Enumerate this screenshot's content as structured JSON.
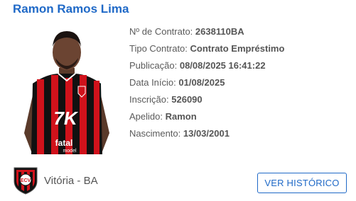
{
  "player": {
    "name": "Ramon Ramos Lima"
  },
  "details": [
    {
      "label": "Nº de Contrato:",
      "value": "2638110BA"
    },
    {
      "label": "Tipo Contrato:",
      "value": "Contrato Empréstimo"
    },
    {
      "label": "Publicação:",
      "value": "08/08/2025 16:41:22"
    },
    {
      "label": "Data Início:",
      "value": "01/08/2025"
    },
    {
      "label": "Inscrição:",
      "value": "526090"
    },
    {
      "label": "Apelido:",
      "value": "Ramon"
    },
    {
      "label": "Nascimento:",
      "value": "13/03/2001"
    }
  ],
  "photo": {
    "jersey_text": "7K",
    "sponsor": "fatal",
    "sponsor_sub": "model"
  },
  "club": {
    "name": "Vitória - BA",
    "crest_letters": "ECV"
  },
  "actions": {
    "history_label": "VER HISTÓRICO"
  },
  "colors": {
    "accent": "#1f69c7",
    "text": "#555555",
    "club_red": "#d0121b",
    "club_black": "#111111"
  }
}
